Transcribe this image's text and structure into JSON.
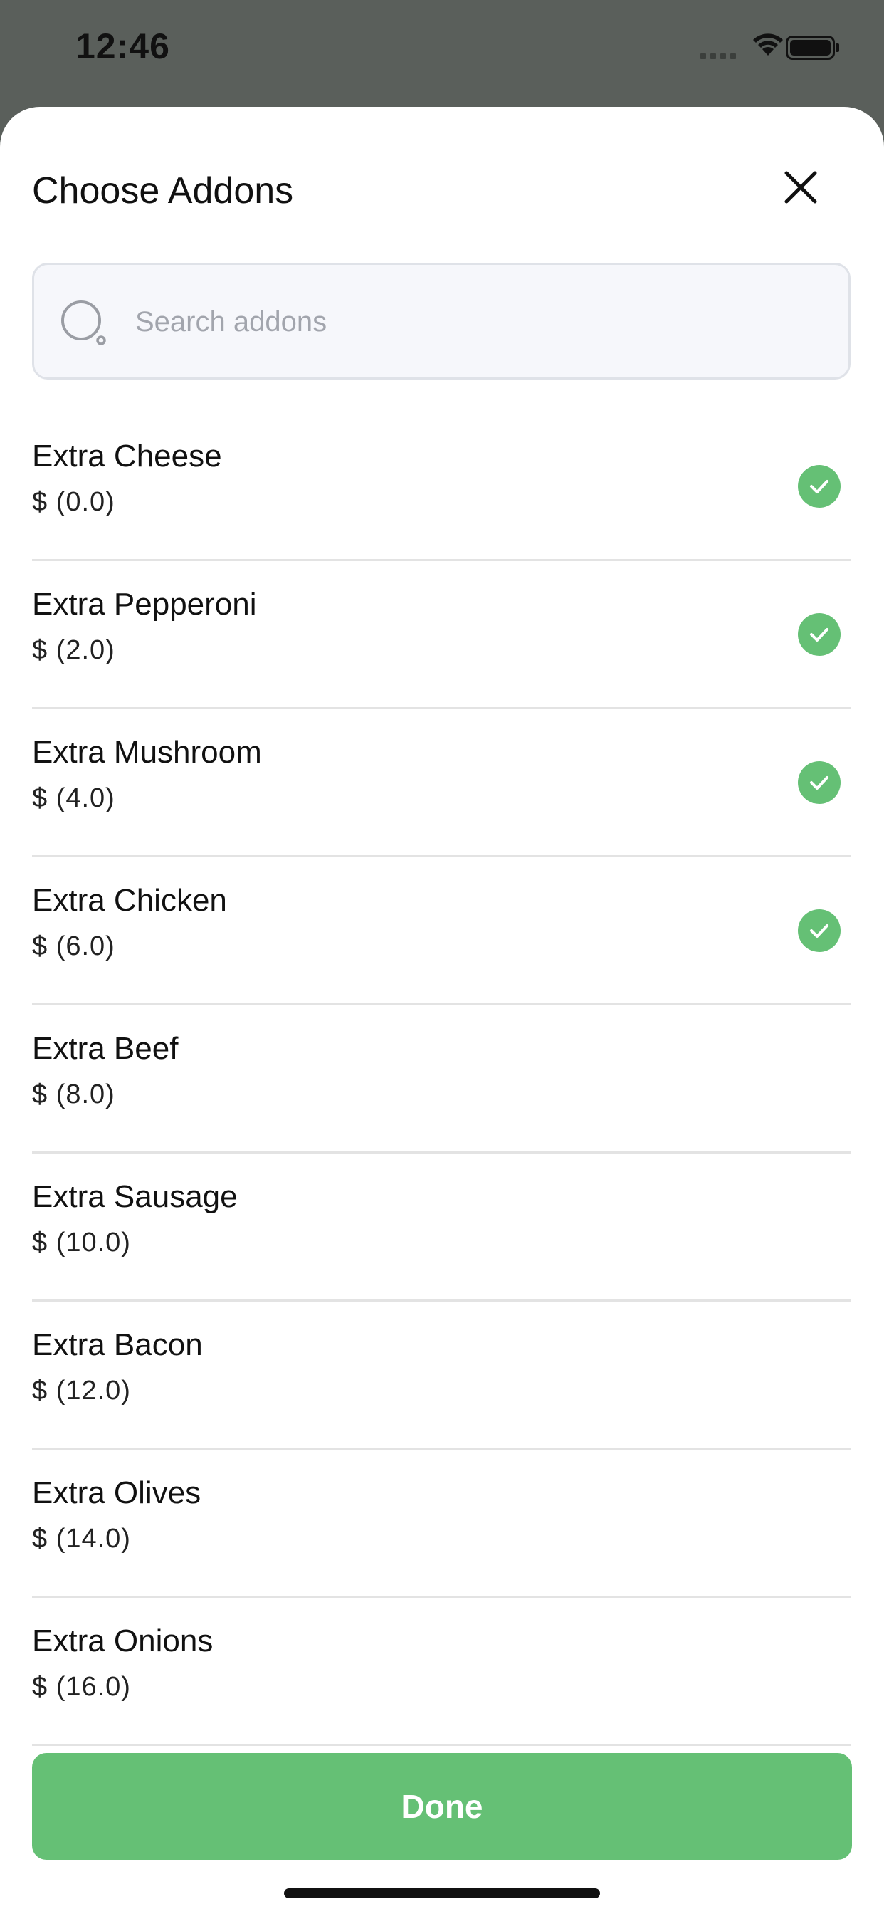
{
  "status_bar": {
    "time": "12:46",
    "icons": [
      "signal-dots-icon",
      "wifi-icon",
      "battery-icon"
    ]
  },
  "sheet": {
    "title": "Choose Addons",
    "close_icon": "close-icon"
  },
  "search": {
    "placeholder": "Search addons",
    "value": "",
    "icon": "search-icon"
  },
  "addons": [
    {
      "name": "Extra Cheese",
      "price": "$ (0.0)",
      "selected": true
    },
    {
      "name": "Extra Pepperoni",
      "price": "$ (2.0)",
      "selected": true
    },
    {
      "name": "Extra Mushroom",
      "price": "$ (4.0)",
      "selected": true
    },
    {
      "name": "Extra Chicken",
      "price": "$ (6.0)",
      "selected": true
    },
    {
      "name": "Extra Beef",
      "price": "$ (8.0)",
      "selected": false
    },
    {
      "name": "Extra Sausage",
      "price": "$ (10.0)",
      "selected": false
    },
    {
      "name": "Extra Bacon",
      "price": "$ (12.0)",
      "selected": false
    },
    {
      "name": "Extra Olives",
      "price": "$ (14.0)",
      "selected": false
    },
    {
      "name": "Extra Onions",
      "price": "$ (16.0)",
      "selected": false
    }
  ],
  "done_label": "Done",
  "colors": {
    "accent": "#65c075",
    "backdrop": "#5a5f5b",
    "sheet": "#ffffff"
  }
}
